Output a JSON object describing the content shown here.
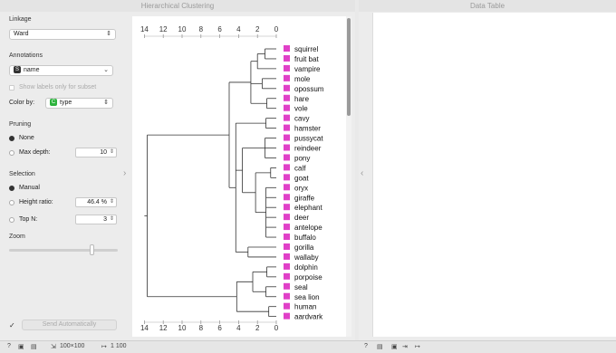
{
  "window1": {
    "title": "Hierarchical Clustering"
  },
  "window2": {
    "title": "Data Table"
  },
  "controls": {
    "linkage": {
      "label": "Linkage",
      "value": "Ward"
    },
    "annotations": {
      "label": "Annotations",
      "value": "name",
      "subset_label": "Show labels only for subset",
      "color_by_label": "Color by:",
      "color_by_value": "type",
      "badge_letter": "C"
    },
    "pruning": {
      "label": "Pruning",
      "none": "None",
      "max_depth": "Max depth:",
      "max_depth_value": "10"
    },
    "selection": {
      "label": "Selection",
      "manual": "Manual",
      "height_ratio": "Height ratio:",
      "height_ratio_value": "46.4 %",
      "top_n": "Top N:",
      "top_n_value": "3"
    },
    "zoom": {
      "label": "Zoom",
      "level": 0.75
    },
    "send": {
      "label": "Send Automatically"
    }
  },
  "dendrogram": {
    "axis_ticks": [
      "14",
      "12",
      "10",
      "8",
      "6",
      "4",
      "2",
      "0"
    ],
    "leaves": [
      "squirrel",
      "fruit bat",
      "vampire",
      "mole",
      "opossum",
      "hare",
      "vole",
      "cavy",
      "hamster",
      "pussycat",
      "reindeer",
      "pony",
      "calf",
      "goat",
      "oryx",
      "giraffe",
      "elephant",
      "deer",
      "antelope",
      "buffalo",
      "gorilla",
      "wallaby",
      "dolphin",
      "porpoise",
      "seal",
      "sea lion",
      "human",
      "aardvark"
    ],
    "leaf_color": "#e040c8"
  },
  "statusbar": {
    "size": "100×100",
    "arrow": "1 100"
  }
}
